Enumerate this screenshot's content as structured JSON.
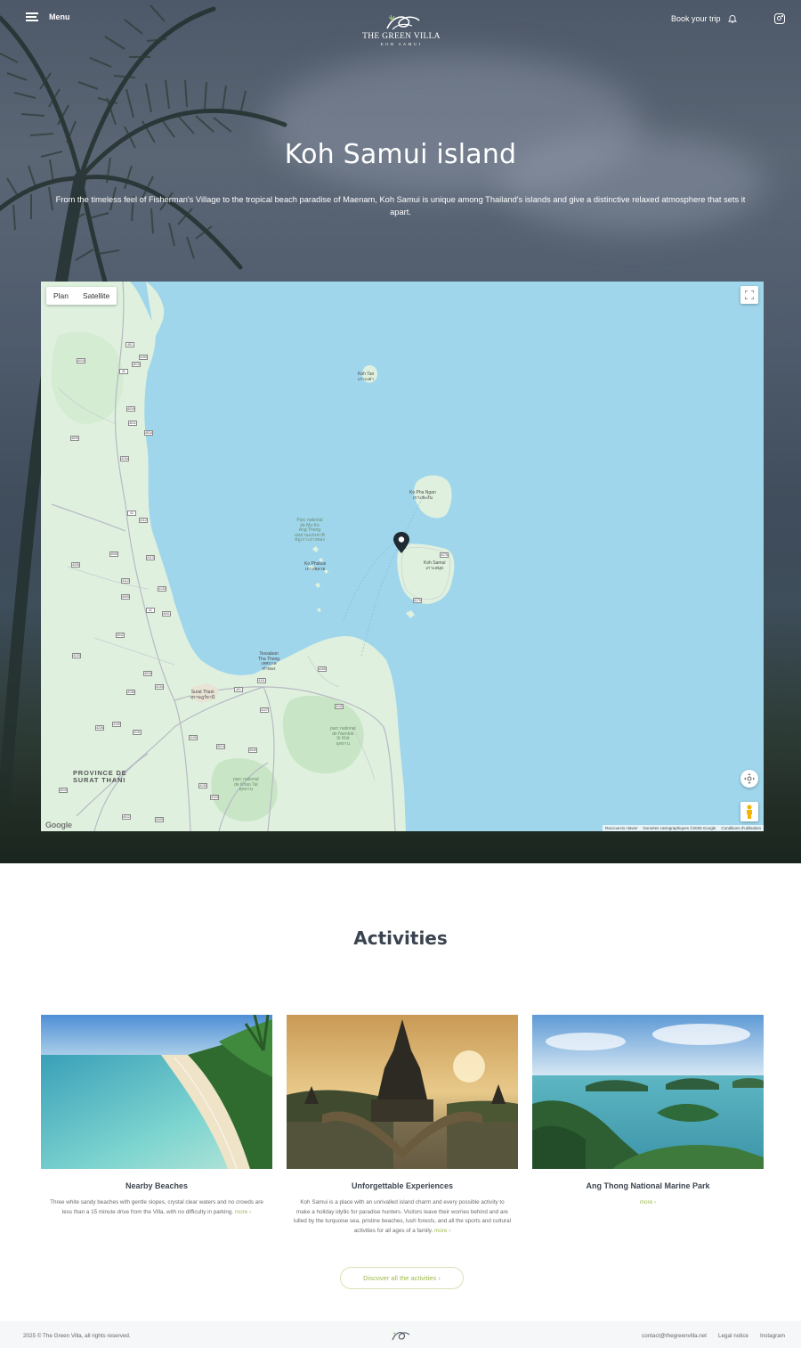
{
  "header": {
    "menu_label": "Menu",
    "brand_name": "THE GREEN VILLA",
    "brand_sub": "KOH SAMUI",
    "book_label": "Book your trip",
    "icons": [
      "menu-icon",
      "logo-icon",
      "bell-icon",
      "instagram-icon"
    ]
  },
  "hero": {
    "title": "Koh Samui island",
    "text": "From the timeless feel of Fisherman's Village to the tropical beach paradise of Maenam, Koh Samui is unique among Thailand's islands and give a distinctive relaxed atmosphere that sets it apart."
  },
  "map": {
    "toggle_plan": "Plan",
    "toggle_satellite": "Satellite",
    "google": "Google",
    "attrib": [
      "Raccourcis clavier",
      "Données cartographiques ©2025 Google",
      "Conditions d'utilisation"
    ],
    "labels": {
      "koh_tao": "Koh Tao\nเกาะเต่า",
      "koh_phangan": "Ko Pha Ngan\nเกาะพะงัน",
      "koh_samui": "Koh Samui\nเกาะสมุย",
      "marine_park": "Parc national\nde Mu Ko\nAng Thong\nอุทยานแห่งชาติ\nหมู่เกาะอ่างทอง",
      "koh_phaluai": "Ko Phaluai\nเกาะพลวย",
      "tessaban": "Tessaban\nTha Thong\nเทศบาล\nท่าทอง",
      "surat_city": "Surat Thani\nสุราษฎร์ธานี",
      "khao_tai": "parc national\nde Khao Tai\nอุทยาน",
      "khanom": "parc national\nde Namtok\nSi Khit\nอุทยาน",
      "province": "PROVINCE DE\nSURAT THANI"
    }
  },
  "activities": {
    "title": "Activities",
    "cards": [
      {
        "title": "Nearby Beaches",
        "text": "Three white sandy beaches with gentle slopes, crystal clear waters and no crowds are less than a 15 minute drive from the Villa, with no difficulty in parking.",
        "more": "more ›"
      },
      {
        "title": "Unforgettable Experiences",
        "text": "Koh Samui is a place with an unrivalled island charm and every possible activity to make a holiday idyllic for paradise hunters. Visitors leave their worries behind and are lulled by the turquoise sea, pristine beaches, lush forests, and all the sports and cultural activities for all ages of a family.",
        "more": "more ›"
      },
      {
        "title": "Ang Thong National Marine Park",
        "text": "",
        "more": "more ›"
      }
    ],
    "discover": "Discover all the activities ›"
  },
  "footer": {
    "copy": "2025 © The Green Villa, all rights reserved.",
    "contact": "contact@thegreenvilla.net",
    "legal": "Legal notice",
    "instagram": "Instagram"
  },
  "colors": {
    "accent": "#a0b94f",
    "map_water": "#9fd6ec",
    "map_land": "#dff1de"
  }
}
